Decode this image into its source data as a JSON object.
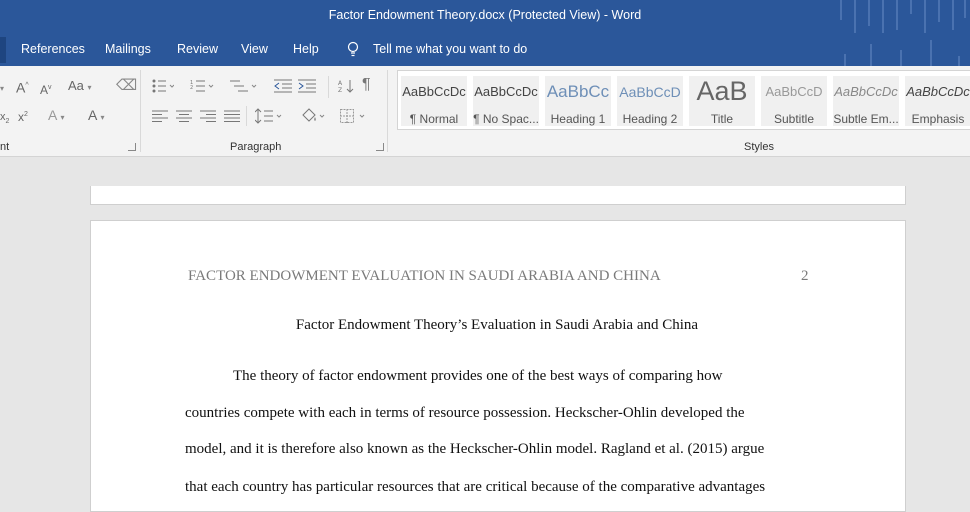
{
  "window": {
    "title": "Factor Endowment Theory.docx (Protected View)  -  Word"
  },
  "menu": {
    "items": [
      "References",
      "Mailings",
      "Review",
      "View",
      "Help"
    ],
    "tell_me": "Tell me what you want to do"
  },
  "ribbon": {
    "font_group_label": "nt",
    "paragraph_group_label": "Paragraph",
    "styles_group_label": "Styles",
    "font_glyphs": {
      "grow": "A",
      "shrink": "A",
      "case": "Aa",
      "subscript": "x",
      "superscript": "x",
      "effects": "A",
      "color": "A"
    },
    "pilcrow": "¶",
    "styles": [
      {
        "sample": "AaBbCcDc",
        "name": "¶ Normal"
      },
      {
        "sample": "AaBbCcDc",
        "name": "¶ No Spac..."
      },
      {
        "sample": "AaBbCc",
        "name": "Heading 1"
      },
      {
        "sample": "AaBbCcD",
        "name": "Heading 2"
      },
      {
        "sample": "AaB",
        "name": "Title"
      },
      {
        "sample": "AaBbCcD",
        "name": "Subtitle"
      },
      {
        "sample": "AaBbCcDc",
        "name": "Subtle Em..."
      },
      {
        "sample": "AaBbCcDc",
        "name": "Emphasis"
      }
    ]
  },
  "document": {
    "running_head": "FACTOR ENDOWMENT EVALUATION IN SAUDI ARABIA AND CHINA",
    "page_number": "2",
    "title": "Factor Endowment Theory’s Evaluation in Saudi Arabia and China",
    "lines": [
      "The theory of factor endowment provides one of the best ways of comparing how",
      "countries compete with each in terms of resource possession. Heckscher-Ohlin developed the",
      "model, and it is therefore also known as the Heckscher-Ohlin model. Ragland et al. (2015) argue",
      "that each country has particular resources that are critical because of the comparative advantages"
    ]
  },
  "colors": {
    "word_blue": "#2b579a",
    "ribbon_bg": "#f3f3f3",
    "canvas": "#e6e6e6"
  }
}
